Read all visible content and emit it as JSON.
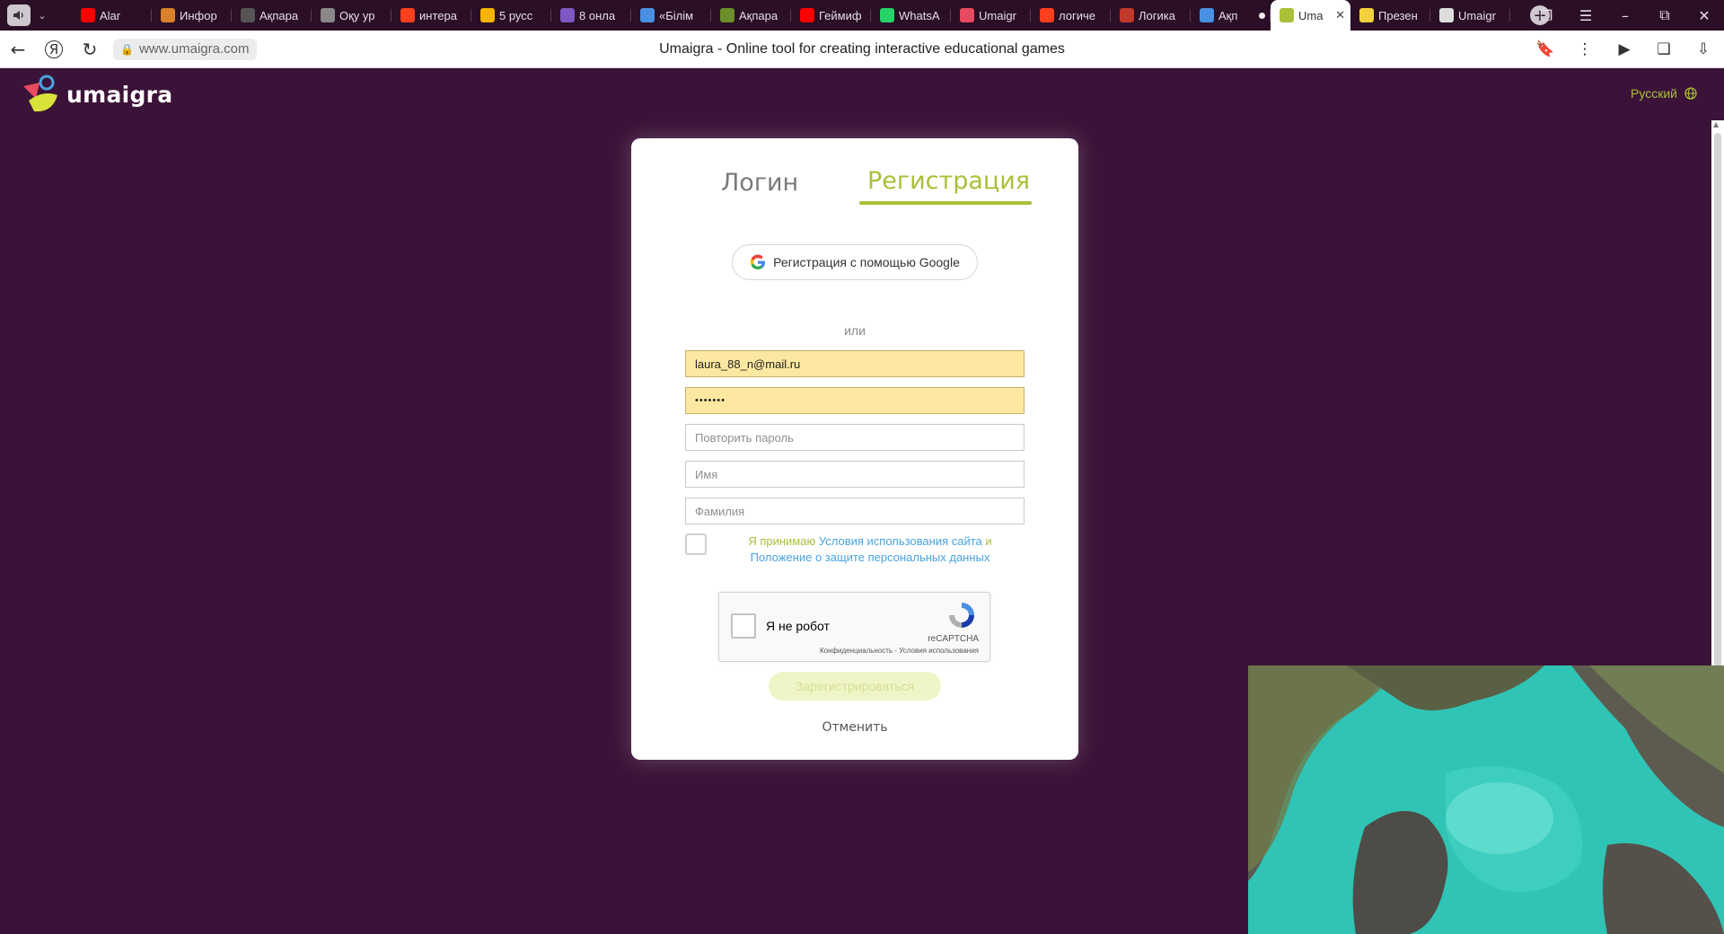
{
  "browser": {
    "tabs": [
      {
        "title": "Alar",
        "icon": "youtube-icon",
        "color": "#ff0000"
      },
      {
        "title": "Инфор",
        "icon": "site-icon",
        "color": "#d9822b"
      },
      {
        "title": "Ақпара",
        "icon": "site-icon",
        "color": "#555555"
      },
      {
        "title": "Оқу ур",
        "icon": "site-icon",
        "color": "#888888"
      },
      {
        "title": "интера",
        "icon": "yandex-icon",
        "color": "#fc3f1d"
      },
      {
        "title": "5 русс",
        "icon": "site-icon",
        "color": "#f4b400"
      },
      {
        "title": "8 онла",
        "icon": "site-icon",
        "color": "#7e57c2"
      },
      {
        "title": "«Білім",
        "icon": "site-icon",
        "color": "#4a90e2"
      },
      {
        "title": "Ақпара",
        "icon": "site-icon",
        "color": "#6a8f2b"
      },
      {
        "title": "Геймиф",
        "icon": "youtube-icon",
        "color": "#ff0000"
      },
      {
        "title": "WhatsA",
        "icon": "whatsapp-icon",
        "color": "#25d366"
      },
      {
        "title": "Umaigr",
        "icon": "site-icon",
        "color": "#e84a5f"
      },
      {
        "title": "логиче",
        "icon": "yandex-icon",
        "color": "#fc3f1d"
      },
      {
        "title": "Логика",
        "icon": "site-icon",
        "color": "#c0392b"
      },
      {
        "title": "Ақп",
        "icon": "site-icon",
        "color": "#4a90e2"
      },
      {
        "title": "Uma",
        "icon": "site-icon",
        "color": "#a9c038"
      },
      {
        "title": "Презен",
        "icon": "site-icon",
        "color": "#f4d03f"
      },
      {
        "title": "Umaigr",
        "icon": "doc-icon",
        "color": "#dddddd"
      }
    ],
    "active_tab_index": 15,
    "url": "www.umaigra.com",
    "page_title": "Umaigra - Online tool for creating interactive educational games"
  },
  "header": {
    "logo_text": "umaigra",
    "language": "Русский"
  },
  "auth": {
    "tab_login": "Логин",
    "tab_register": "Регистрация",
    "google_button": "Регистрация с помощью Google",
    "or_label": "или",
    "email_value": "laura_88_n@mail.ru",
    "password_value": "•••••••",
    "repeat_password_placeholder": "Повторить пароль",
    "name_placeholder": "Имя",
    "surname_placeholder": "Фамилия",
    "terms_prefix": "Я принимаю ",
    "terms_link": "Условия использования сайта",
    "terms_and": " и ",
    "privacy_link": "Положение о защите персональных данных",
    "recaptcha_label": "Я не робот",
    "recaptcha_brand": "reCAPTCHA",
    "recaptcha_links": "Конфиденциальность - Условия использования",
    "submit_button": "Зарегистрироваться",
    "cancel_link": "Отменить"
  },
  "colors": {
    "page_bg": "#3b1338",
    "accent": "#a9c038",
    "link": "#4aa3df",
    "autofill": "#fce8a0"
  }
}
